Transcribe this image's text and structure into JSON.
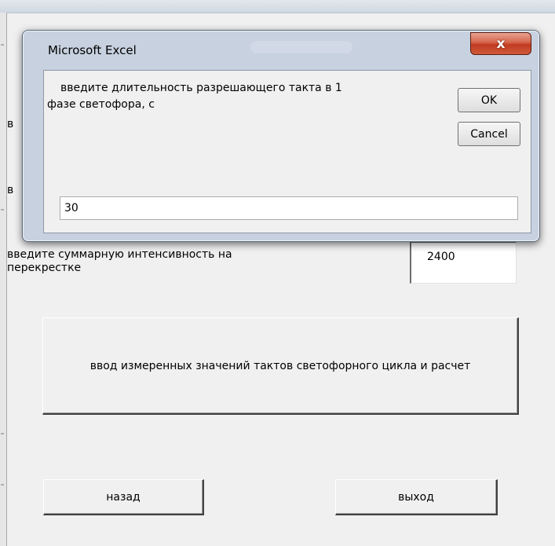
{
  "dialog": {
    "title": "Microsoft Excel",
    "close_label": "x",
    "prompt_line1": "введите длительность разрешающего такта в 1",
    "prompt_line2": "фазе светофора, с",
    "ok_label": "OK",
    "cancel_label": "Cancel",
    "input_value": "30"
  },
  "form": {
    "hidden_label_1_initial": "в",
    "hidden_label_2_initial": "в",
    "intensity_label_line1": "введите суммарную интенсивность на",
    "intensity_label_line2": "перекрестке",
    "intensity_value": "2400",
    "measure_button_label": "ввод измеренных значений тактов светофорного цикла и расчет",
    "back_button_label": "назад",
    "exit_button_label": "выход"
  }
}
